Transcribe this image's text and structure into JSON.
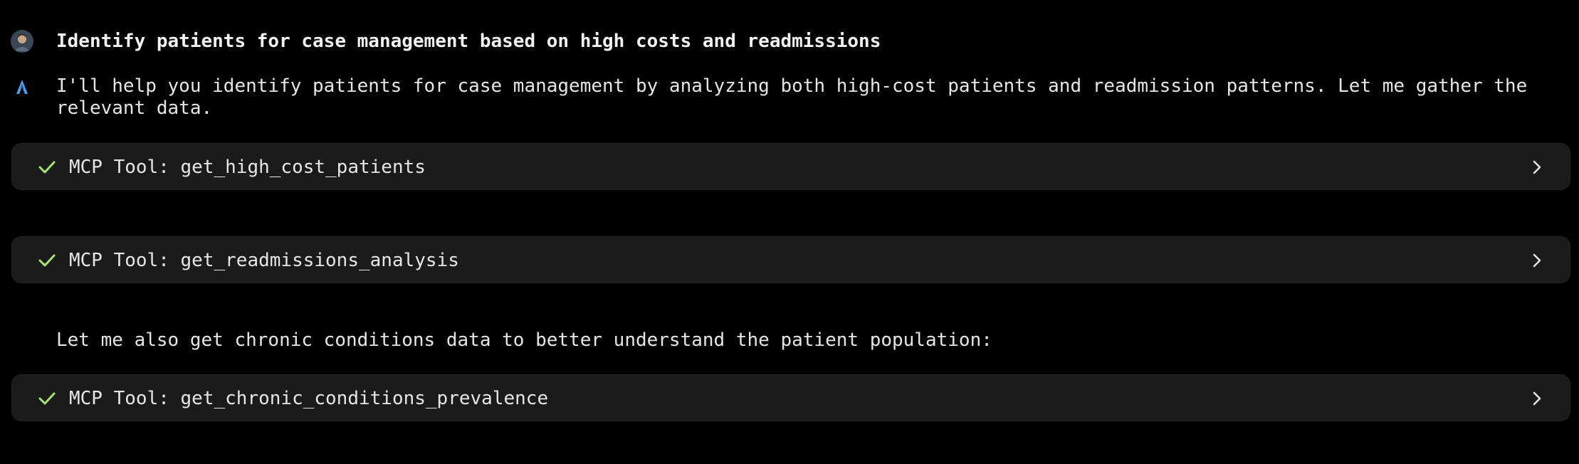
{
  "user_message": {
    "text": "Identify patients for case management based on high costs and readmissions",
    "avatar": "user-avatar-photo"
  },
  "assistant_message": {
    "icon": "assistant-logo-icon",
    "text": "I'll help you identify patients for case management by analyzing both high-cost patients and readmission patterns. Let me gather the relevant data."
  },
  "tool_calls": [
    {
      "label": "MCP Tool: get_high_cost_patients",
      "status": "complete",
      "status_icon": "check-icon",
      "expand_icon": "chevron-right-icon"
    },
    {
      "label": "MCP Tool: get_readmissions_analysis",
      "status": "complete",
      "status_icon": "check-icon",
      "expand_icon": "chevron-right-icon"
    },
    {
      "label": "MCP Tool: get_chronic_conditions_prevalence",
      "status": "complete",
      "status_icon": "check-icon",
      "expand_icon": "chevron-right-icon"
    }
  ],
  "followup_text": "Let me also get chronic conditions data to better understand the patient population:",
  "colors": {
    "background": "#000000",
    "card_background": "#1b1b1b",
    "check_green": "#a6e36e",
    "assistant_icon_blue": "#4ea1e8",
    "text": "#e6e6e6"
  }
}
